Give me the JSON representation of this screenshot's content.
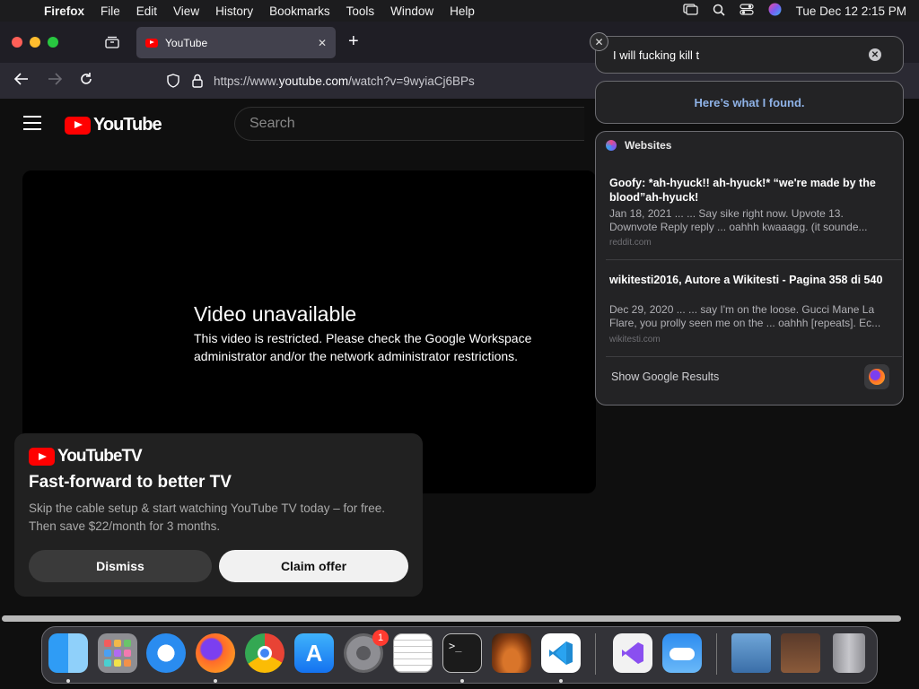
{
  "menubar": {
    "app_name": "Firefox",
    "items": [
      "File",
      "Edit",
      "View",
      "History",
      "Bookmarks",
      "Tools",
      "Window",
      "Help"
    ],
    "clock": "Tue Dec 12  2:15 PM"
  },
  "browser": {
    "tab_title": "YouTube",
    "tab_close": "✕",
    "new_tab": "+",
    "url_prefix": "https://www.",
    "url_domain": "youtube.com",
    "url_path": "/watch?v=9wyiaCj6BPs"
  },
  "youtube": {
    "logo_text": "YouTube",
    "search_placeholder": "Search",
    "video_title": "Video unavailable",
    "video_message": "This video is restricted. Please check the Google Workspace administrator and/or the network administrator restrictions."
  },
  "promo": {
    "logo_text": "YouTubeTV",
    "title": "Fast-forward to better TV",
    "body": "Skip the cable setup & start watching YouTube TV today – for free. Then save $22/month for 3 months.",
    "dismiss_label": "Dismiss",
    "claim_label": "Claim offer"
  },
  "siri": {
    "query": "I will fucking kill t",
    "found_message": "Here’s what I found.",
    "section_title": "Websites",
    "results": [
      {
        "title": "Goofy: *ah-hyuck!! ah-hyuck!* “we're made by the blood”ah-hyuck!",
        "snippet": "Jan 18, 2021 ... ... Say sike right now. Upvote 13. Downvote Reply reply ... oahhh kwaaagg. (it sounde...",
        "source": "reddit.com"
      },
      {
        "title": "wikitesti2016, Autore a Wikitesti - Pagina 358 di 540",
        "snippet": "Dec 29, 2020 ... ... say I'm on the loose. Gucci Mane La Flare, you prolly seen me on the ... oahhh [repeats]. Ec...",
        "source": "wikitesti.com"
      }
    ],
    "show_google_label": "Show Google Results"
  },
  "dock": {
    "settings_badge": "1",
    "apps": [
      "finder-icon",
      "launchpad-icon",
      "safari-icon",
      "firefox-icon",
      "chrome-icon",
      "app-store-icon",
      "system-settings-icon",
      "textedit-icon",
      "terminal-icon",
      "garageband-icon",
      "vscode-icon",
      "visual-studio-icon",
      "weather-icon",
      "downloads-stack-icon",
      "screenshot-stack-icon",
      "trash-icon"
    ]
  }
}
